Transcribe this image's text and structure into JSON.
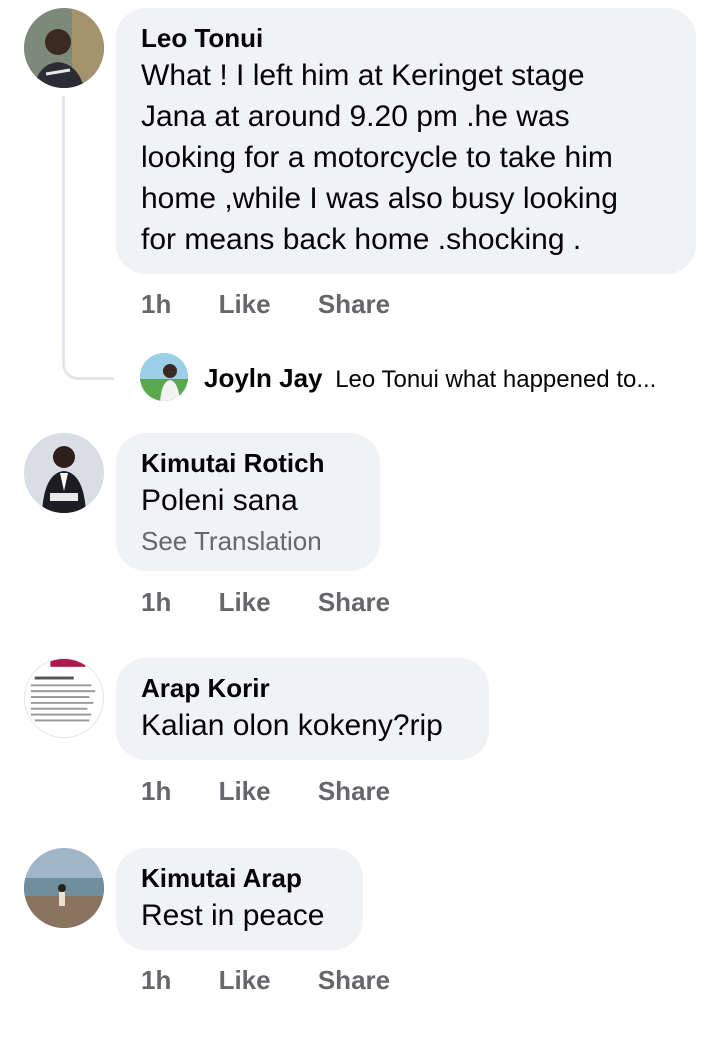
{
  "comments": [
    {
      "author": "Leo Tonui",
      "lines": [
        "What ! I left him at Keringet stage",
        "Jana at around 9.20 pm .he was",
        "looking for a motorcycle to take him",
        "home ,while I was also busy looking",
        "for means back home .shocking ."
      ],
      "time": "1h",
      "like": "Like",
      "share": "Share",
      "reply": {
        "author": "Joyln Jay",
        "preview": "Leo Tonui what happened to..."
      }
    },
    {
      "author": "Kimutai Rotich",
      "text": "Poleni sana",
      "translate": "See Translation",
      "time": "1h",
      "like": "Like",
      "share": "Share"
    },
    {
      "author": "Arap Korir",
      "text": "Kalian olon kokeny?rip",
      "time": "1h",
      "like": "Like",
      "share": "Share"
    },
    {
      "author": "Kimutai Arap",
      "text": "Rest in peace",
      "time": "1h",
      "like": "Like",
      "share": "Share"
    }
  ],
  "colors": {
    "bubble": "#f0f2f5",
    "meta": "#65676b",
    "text": "#050505",
    "thread": "#e4e6eb"
  }
}
